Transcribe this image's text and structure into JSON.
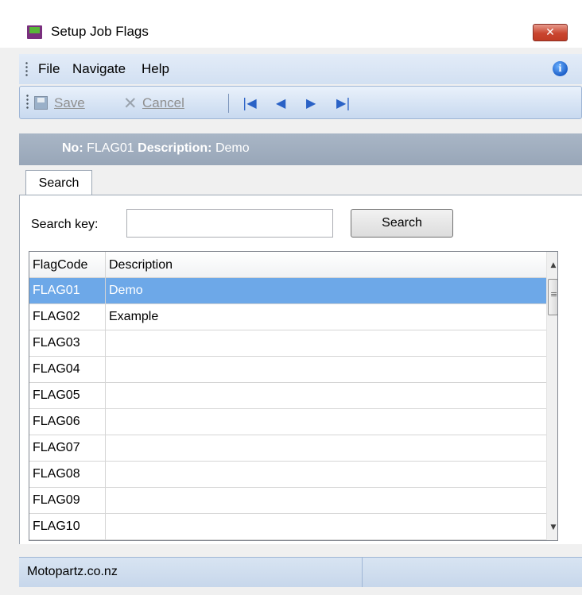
{
  "window": {
    "title": "Setup Job Flags",
    "close_glyph": "✕"
  },
  "menu": {
    "items": [
      "File",
      "Navigate",
      "Help"
    ]
  },
  "toolbar": {
    "save_label": "Save",
    "cancel_label": "Cancel"
  },
  "record": {
    "no_label": "No:",
    "no_value": "FLAG01",
    "desc_label": "Description:",
    "desc_value": "Demo"
  },
  "tabs": [
    "Search"
  ],
  "search": {
    "label": "Search key:",
    "value": "",
    "button": "Search"
  },
  "grid": {
    "columns": [
      "FlagCode",
      "Description"
    ],
    "rows": [
      {
        "code": "FLAG01",
        "desc": "Demo",
        "selected": true
      },
      {
        "code": "FLAG02",
        "desc": "Example"
      },
      {
        "code": "FLAG03",
        "desc": ""
      },
      {
        "code": "FLAG04",
        "desc": ""
      },
      {
        "code": "FLAG05",
        "desc": ""
      },
      {
        "code": "FLAG06",
        "desc": ""
      },
      {
        "code": "FLAG07",
        "desc": ""
      },
      {
        "code": "FLAG08",
        "desc": ""
      },
      {
        "code": "FLAG09",
        "desc": ""
      },
      {
        "code": "FLAG10",
        "desc": ""
      }
    ]
  },
  "status": {
    "text": "Motopartz.co.nz"
  },
  "colors": {
    "selected_row": "#6da8e8",
    "header_band": "#98a6b8",
    "toolbar": "#c8d9ef"
  }
}
